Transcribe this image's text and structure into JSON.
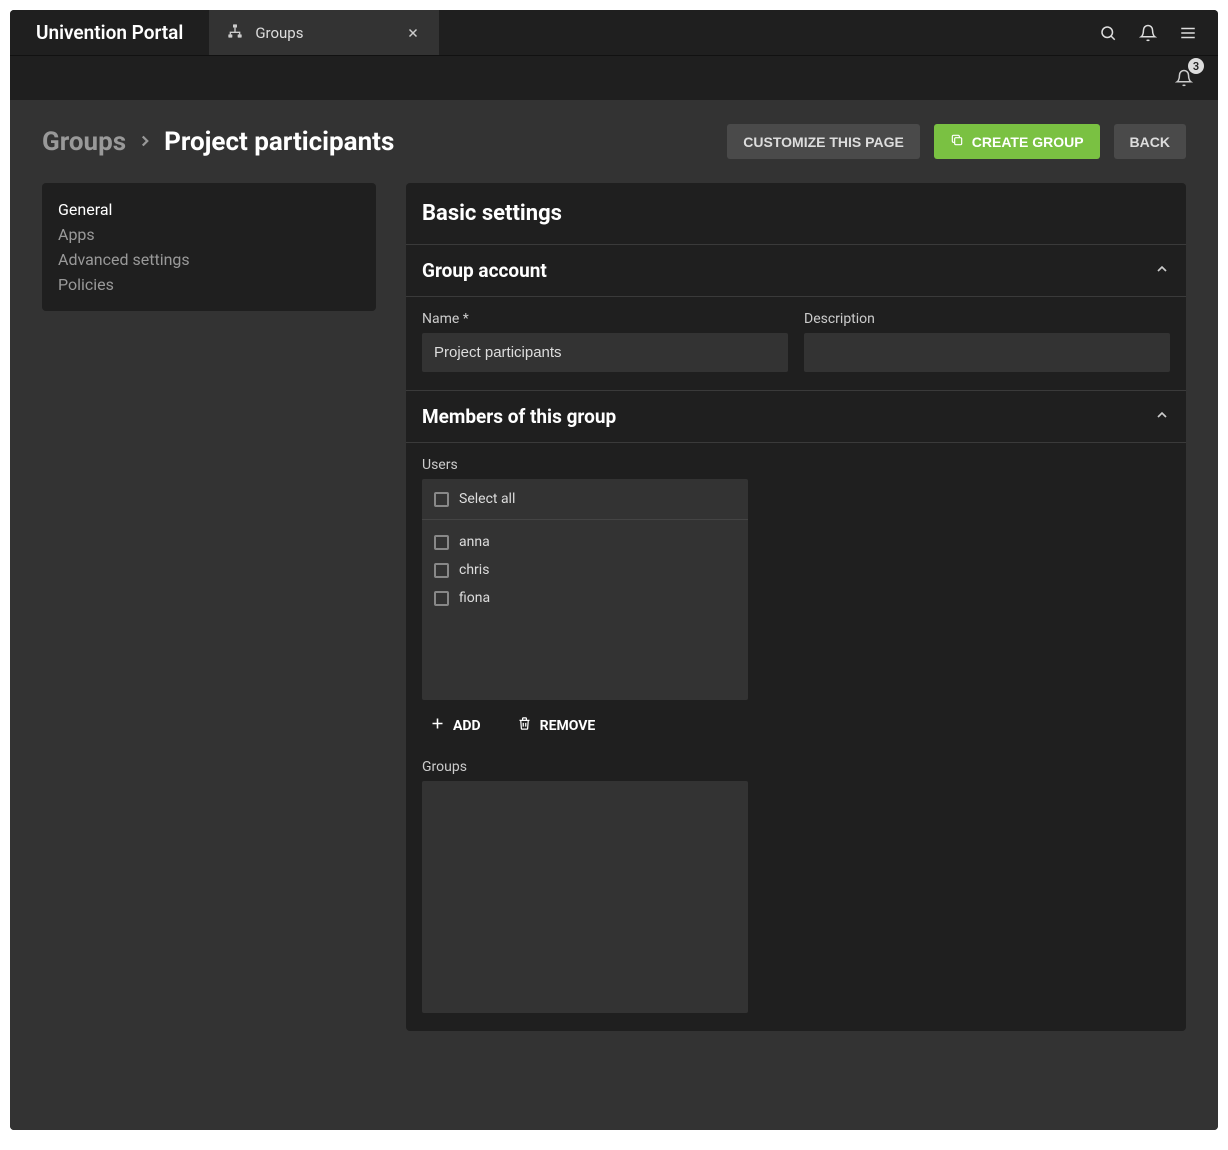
{
  "app": {
    "title": "Univention Portal"
  },
  "tab": {
    "label": "Groups"
  },
  "notifications": {
    "count": "3"
  },
  "breadcrumb": {
    "root": "Groups",
    "current": "Project participants"
  },
  "buttons": {
    "customize": "CUSTOMIZE THIS PAGE",
    "create": "CREATE GROUP",
    "back": "BACK"
  },
  "sidebar": {
    "items": [
      {
        "label": "General",
        "active": true
      },
      {
        "label": "Apps",
        "active": false
      },
      {
        "label": "Advanced settings",
        "active": false
      },
      {
        "label": "Policies",
        "active": false
      }
    ]
  },
  "panel": {
    "title": "Basic settings",
    "sections": {
      "group_account": {
        "title": "Group account",
        "fields": {
          "name": {
            "label": "Name *",
            "value": "Project participants"
          },
          "description": {
            "label": "Description",
            "value": ""
          }
        }
      },
      "members": {
        "title": "Members of this group",
        "users": {
          "label": "Users",
          "select_all": "Select all",
          "items": [
            "anna",
            "chris",
            "fiona"
          ],
          "add": "ADD",
          "remove": "REMOVE"
        },
        "groups": {
          "label": "Groups"
        }
      }
    }
  }
}
